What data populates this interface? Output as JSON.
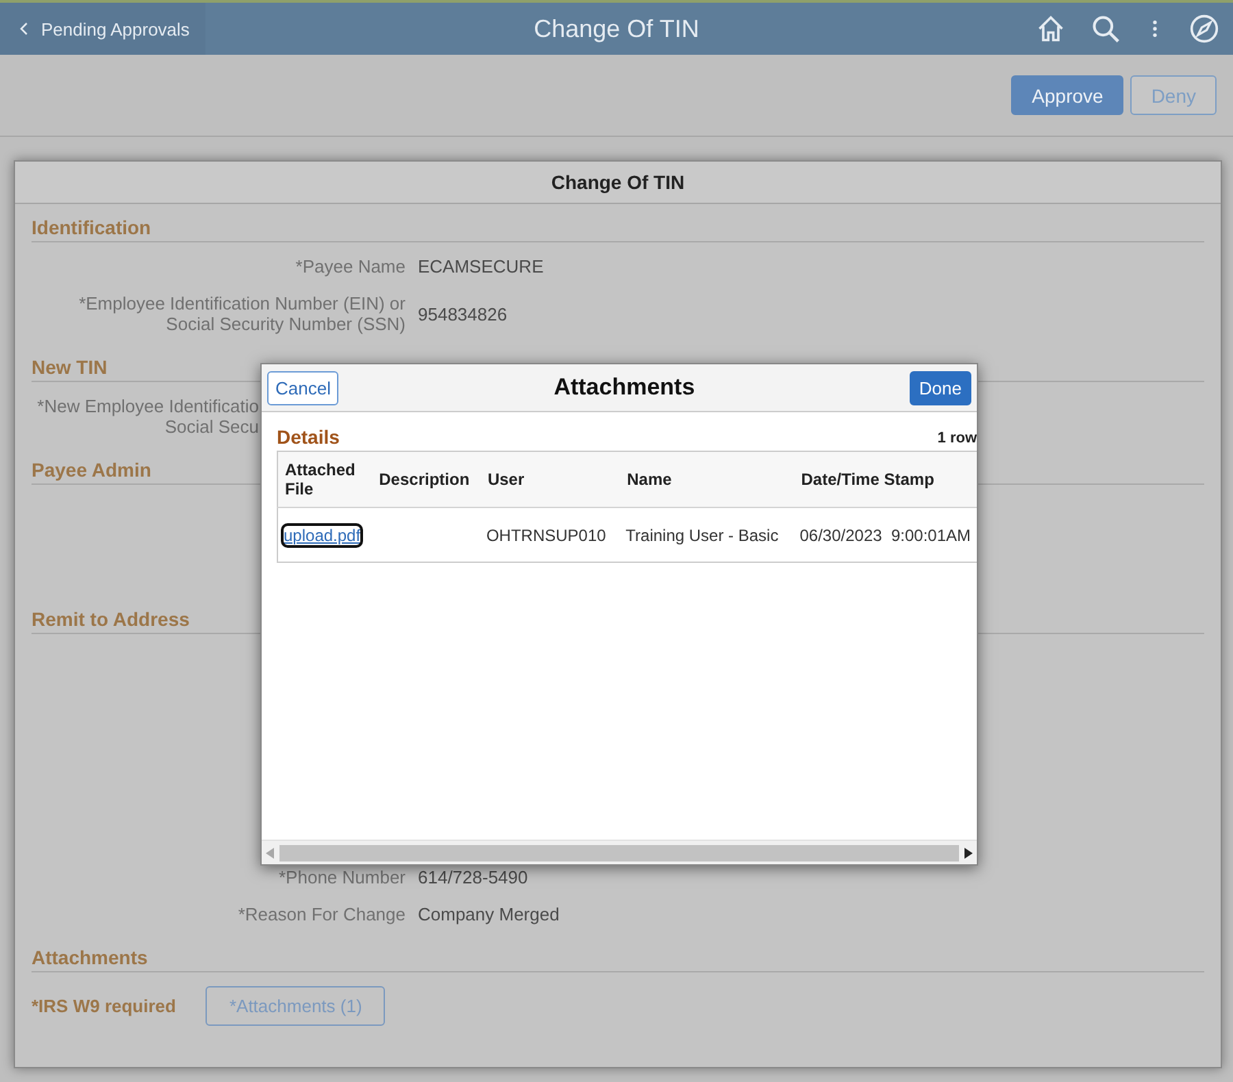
{
  "header": {
    "back_label": "Pending Approvals",
    "title": "Change Of TIN"
  },
  "toolbar": {
    "buttons": [
      {
        "label": "Approve",
        "kind": "primary"
      },
      {
        "label": "Deny",
        "kind": "secondary"
      }
    ]
  },
  "dialog": {
    "title": "Change Of TIN",
    "sections": [
      {
        "heading": "Identification",
        "fields": [
          {
            "label": "*Payee Name",
            "value": "ECAMSECURE"
          },
          {
            "label": "*Employee Identification Number (EIN) or\nSocial Security Number (SSN)",
            "value": "954834826"
          }
        ]
      },
      {
        "heading": "New TIN",
        "fields": [
          {
            "label": "*New Employee Identificatio\nSocial Secu",
            "kind": "covered"
          }
        ]
      },
      {
        "heading": "Payee Admin"
      },
      {
        "heading": "Remit to Address",
        "fields": [
          {
            "label": "*Phone Number",
            "value": "614/728-5490"
          },
          {
            "label": "*Reason For Change",
            "value": "Company Merged"
          }
        ]
      },
      {
        "heading": "Attachments",
        "note": "*IRS W9 required",
        "button": "*Attachments (1)"
      }
    ]
  },
  "attachments_dialog": {
    "cancel": "Cancel",
    "title": "Attachments",
    "done": "Done",
    "section": "Details",
    "row_count": "1 row",
    "columns": [
      "Attached File",
      "Description",
      "User",
      "Name",
      "Date/Time Stamp"
    ],
    "rows": [
      {
        "attached_file": "upload.pdf",
        "focused": true,
        "user": "OHTRNSUP010",
        "name": "Training User - Basic",
        "date_time_stamp": "06/30/2023  9:00:01AM"
      }
    ]
  }
}
